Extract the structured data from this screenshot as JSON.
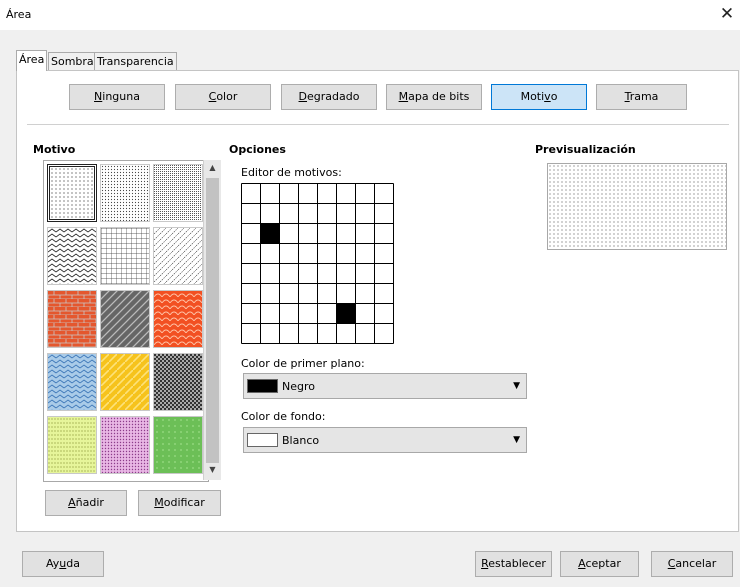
{
  "window": {
    "title": "Área",
    "close_glyph": "✕"
  },
  "tabs": [
    {
      "label": "Área",
      "active": true
    },
    {
      "label": "Sombra",
      "active": false
    },
    {
      "label": "Transparencia",
      "active": false
    }
  ],
  "fill_buttons": [
    {
      "pre": "",
      "acc": "N",
      "post": "inguna",
      "selected": false
    },
    {
      "pre": "",
      "acc": "C",
      "post": "olor",
      "selected": false
    },
    {
      "pre": "",
      "acc": "D",
      "post": "egradado",
      "selected": false
    },
    {
      "pre": "",
      "acc": "M",
      "post": "apa de bits",
      "selected": false
    },
    {
      "pre": "Moti",
      "acc": "v",
      "post": "o",
      "selected": true
    },
    {
      "pre": "",
      "acc": "T",
      "post": "rama",
      "selected": false
    }
  ],
  "pattern_section": {
    "heading": "Motivo",
    "add": {
      "pre": "",
      "acc": "A",
      "post": "ñadir"
    },
    "modify": {
      "pre": "",
      "acc": "M",
      "post": "odificar"
    }
  },
  "options": {
    "heading": "Opciones",
    "editor_label": "Editor de motivos:",
    "filled_cells": [
      [
        1,
        2
      ],
      [
        5,
        6
      ]
    ],
    "fg_label": "Color de primer plano:",
    "fg_value": "Negro",
    "fg_color": "#000000",
    "bg_label": "Color de fondo:",
    "bg_value": "Blanco",
    "bg_color": "#ffffff"
  },
  "preview": {
    "heading": "Previsualización"
  },
  "footer": {
    "help": {
      "pre": "Ay",
      "acc": "u",
      "post": "da"
    },
    "reset": {
      "pre": "",
      "acc": "R",
      "post": "establecer"
    },
    "ok": {
      "pre": "",
      "acc": "A",
      "post": "ceptar"
    },
    "cancel": {
      "pre": "",
      "acc": "C",
      "post": "ancelar"
    }
  }
}
